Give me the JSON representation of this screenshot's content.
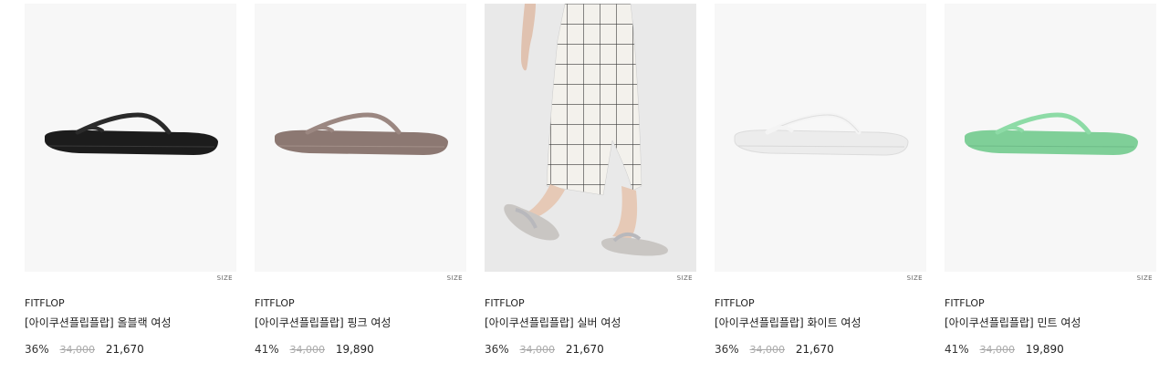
{
  "products": [
    {
      "brand": "FITFLOP",
      "name": "[아이쿠션플립플랍] 올블랙 여성",
      "discount": "36%",
      "original_price": "34,000",
      "sale_price": "21,670",
      "size_label": "SIZE",
      "image": "black-flip-flop",
      "sandal_color": "#1c1c1c",
      "strap_color": "#2a2a2a"
    },
    {
      "brand": "FITFLOP",
      "name": "[아이쿠션플립플랍] 핑크 여성",
      "discount": "41%",
      "original_price": "34,000",
      "sale_price": "19,890",
      "size_label": "SIZE",
      "image": "taupe-pink-flip-flop",
      "sandal_color": "#8c7872",
      "strap_color": "#9b8781"
    },
    {
      "brand": "FITFLOP",
      "name": "[아이쿠션플립플랍] 실버 여성",
      "discount": "36%",
      "original_price": "34,000",
      "sale_price": "21,670",
      "size_label": "SIZE",
      "image": "model-wearing-silver-flip-flops",
      "sandal_color": "#c9c6c3",
      "strap_color": "#b8b8bc"
    },
    {
      "brand": "FITFLOP",
      "name": "[아이쿠션플립플랍] 화이트 여성",
      "discount": "36%",
      "original_price": "34,000",
      "sale_price": "21,670",
      "size_label": "SIZE",
      "image": "white-flip-flop",
      "sandal_color": "#ececec",
      "strap_color": "#f4f4f4"
    },
    {
      "brand": "FITFLOP",
      "name": "[아이쿠션플립플랍] 민트 여성",
      "discount": "41%",
      "original_price": "34,000",
      "sale_price": "19,890",
      "size_label": "SIZE",
      "image": "mint-flip-flop",
      "sandal_color": "#7fcf98",
      "strap_color": "#8ddba6"
    }
  ]
}
